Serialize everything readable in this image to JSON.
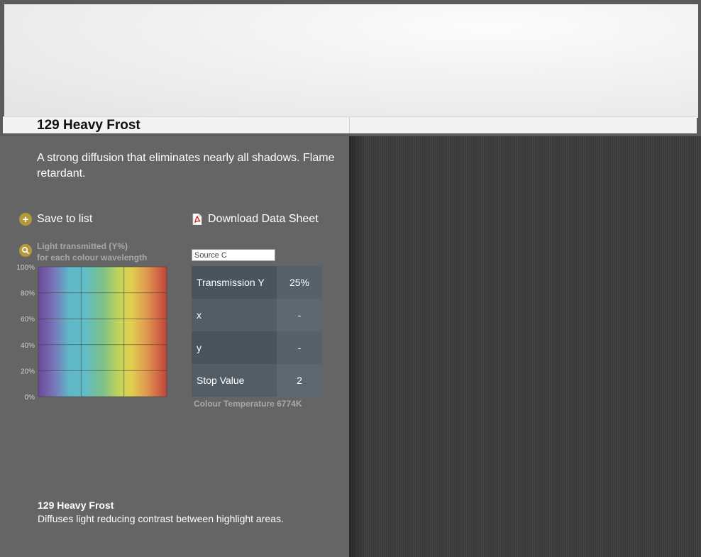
{
  "product": {
    "title": "129 Heavy Frost",
    "description": "A strong diffusion that eliminates nearly all shadows. Flame retardant."
  },
  "actions": {
    "save_label": "Save to list",
    "download_label": "Download Data Sheet"
  },
  "graph": {
    "caption_line1": "Light transmitted (Y%)",
    "caption_line2": "for each colour wavelength"
  },
  "chart_data": {
    "type": "area",
    "title": "",
    "xlabel": "",
    "ylabel": "",
    "yticks": [
      "100%",
      "80%",
      "60%",
      "40%",
      "20%",
      "0%"
    ],
    "ylim": [
      0,
      100
    ],
    "grid": true,
    "note": "Spectral transmission curve not distinguishable; only rainbow spectrum background and grid visible"
  },
  "source": {
    "selected": "Source C"
  },
  "specs": {
    "rows": [
      {
        "label": "Transmission Y",
        "value": "25%"
      },
      {
        "label": "x",
        "value": "-"
      },
      {
        "label": "y",
        "value": "-"
      },
      {
        "label": "Stop Value",
        "value": "2"
      }
    ],
    "colour_temperature": "Colour Temperature 6774K"
  },
  "footer": {
    "title": "129 Heavy Frost",
    "text": "Diffuses light reducing contrast between highlight areas."
  },
  "colors": {
    "panel": "#656565",
    "accent": "#b59a3a",
    "table_key": "#4a545d",
    "table_value": "#56616a"
  },
  "icons": {
    "save": "plus-circle-icon",
    "download": "pdf-icon",
    "graph": "magnifier-icon"
  }
}
